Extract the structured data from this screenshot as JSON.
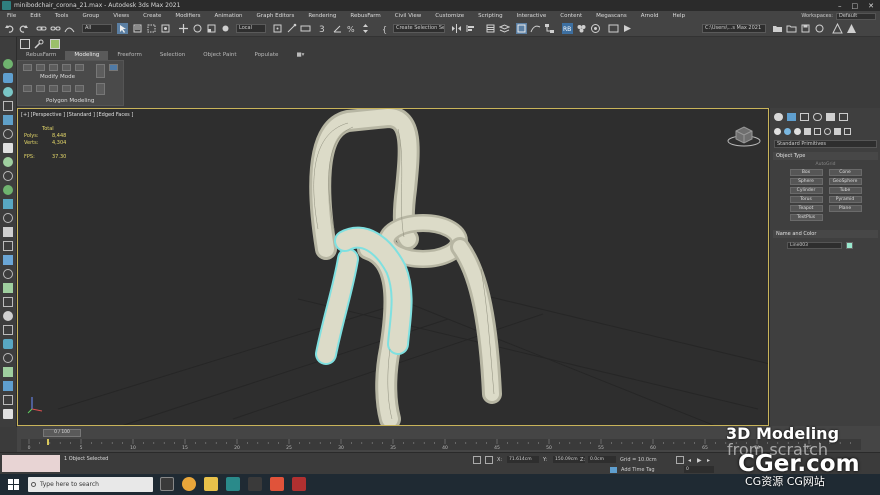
{
  "window": {
    "title": "minibodchair_corona_21.max - Autodesk 3ds Max 2021",
    "controls": [
      "–",
      "□",
      "✕"
    ]
  },
  "menu": {
    "items": [
      "File",
      "Edit",
      "Tools",
      "Group",
      "Views",
      "Create",
      "Modifiers",
      "Animation",
      "Graph Editors",
      "Rendering",
      "RebusFarm",
      "Civil View",
      "Customize",
      "Scripting",
      "Interactive",
      "Content",
      "Megascans",
      "Arnold",
      "Help"
    ],
    "workspace_label": "Workspaces:",
    "workspace_value": "Default"
  },
  "toolbar": {
    "filter": "All",
    "coord": "Local",
    "selection_set": "Create Selection Se",
    "project_path": "C:\\Users\\...s Max 2021"
  },
  "ribbon": {
    "tabs": [
      "RebusFarm",
      "Modeling",
      "Freeform",
      "Selection",
      "Object Paint",
      "Populate"
    ],
    "active_tab": "Modeling",
    "modify_mode": "Modify Mode",
    "polygon_modeling": "Polygon Modeling"
  },
  "viewport": {
    "label": "[+] [Perspective ] [Standard ] [Edged Faces ]",
    "stats": {
      "total_label": "Total",
      "polys_label": "Polys:",
      "polys": "8,448",
      "verts_label": "Verts:",
      "verts": "4,304",
      "fps_label": "FPS:",
      "fps": "37.30"
    }
  },
  "command_panel": {
    "dropdown": "Standard Primitives",
    "object_type": "Object Type",
    "autogrid": "AutoGrid",
    "primitives": [
      "Box",
      "Cone",
      "Sphere",
      "GeoSphere",
      "Cylinder",
      "Tube",
      "Torus",
      "Pyramid",
      "Teapot",
      "Plane",
      "TextPlus"
    ],
    "name_color": "Name and Color",
    "object_name": "Line003",
    "swatch_color": "#99eacf"
  },
  "timeline": {
    "frame": "0 / 100",
    "ticks": [
      "0",
      "5",
      "10",
      "15",
      "20",
      "25",
      "30",
      "35",
      "40",
      "45",
      "50",
      "55",
      "60",
      "65",
      "70",
      "75",
      "80"
    ]
  },
  "status": {
    "selected": "1 Object Selected",
    "x_label": "X:",
    "x": "71.614cm",
    "y_label": "Y:",
    "y": "150.09cm",
    "z_label": "Z:",
    "z": "0.0cm",
    "grid": "Grid = 10.0cm",
    "add_time_tag": "Add Time Tag",
    "frame_field": "0"
  },
  "taskbar": {
    "search_placeholder": "Type here to search"
  },
  "watermark": {
    "line1": "3D Modeling",
    "line2": "from scratch",
    "line3": "CGer.com",
    "line4": "CG资源 CG网站"
  },
  "colors": {
    "accent": "#c9b45a",
    "selection": "#7fe0e0",
    "wire": "#d7d6c4"
  }
}
